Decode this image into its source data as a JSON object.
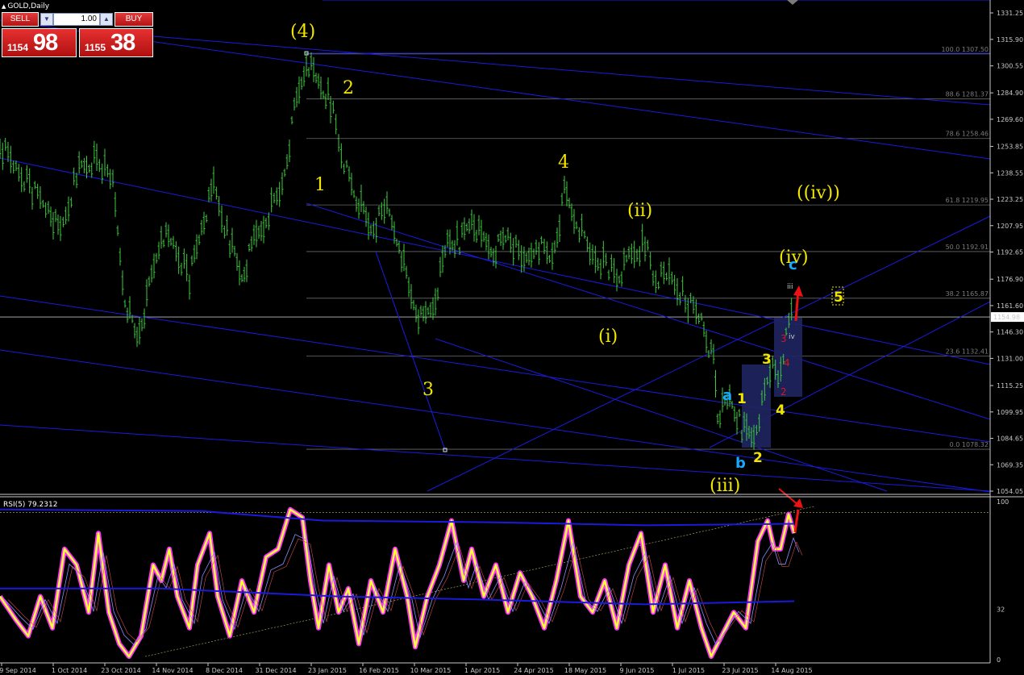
{
  "window": {
    "title": "GOLD,Daily",
    "menu_arrow_icon": "triangle-up-icon"
  },
  "trade_panel": {
    "sell_label": "SELL",
    "buy_label": "BUY",
    "lot_value": "1.00",
    "sell_price_small": "1154",
    "sell_price_big": "98",
    "buy_price_small": "1155",
    "buy_price_big": "38"
  },
  "price_axis": [
    "1331.25",
    "1315.90",
    "1300.55",
    "1284.90",
    "1269.60",
    "1253.85",
    "1238.55",
    "1223.25",
    "1207.95",
    "1192.65",
    "1176.90",
    "1161.60",
    "1146.30",
    "1131.00",
    "1115.25",
    "1099.95",
    "1084.65",
    "1069.35",
    "1054.05"
  ],
  "current_price": "1154.98",
  "fib_levels": [
    {
      "label": "100.0  1307.50",
      "price": 1307.5
    },
    {
      "label": "88.6  1281.37",
      "price": 1281.37
    },
    {
      "label": "78.6  1258.46",
      "price": 1258.46
    },
    {
      "label": "61.8  1219.95",
      "price": 1219.95
    },
    {
      "label": "50.0  1192.91",
      "price": 1192.91
    },
    {
      "label": "38.2  1165.87",
      "price": 1165.87
    },
    {
      "label": "23.6  1132.41",
      "price": 1132.41
    },
    {
      "label": "0.0  1078.32",
      "price": 1078.32
    }
  ],
  "date_axis": [
    "9 Sep 2014",
    "1 Oct 2014",
    "23 Oct 2014",
    "14 Nov 2014",
    "8 Dec 2014",
    "31 Dec 2014",
    "23 Jan 2015",
    "16 Feb 2015",
    "10 Mar 2015",
    "1 Apr 2015",
    "24 Apr 2015",
    "18 May 2015",
    "9 Jun 2015",
    "1 Jul 2015",
    "23 Jul 2015",
    "14 Aug 2015"
  ],
  "wave_labels": {
    "big": [
      "(4)",
      "(iii)",
      "(ii)",
      "(i)",
      "(iv)",
      "((iv))"
    ],
    "numbers": [
      "1",
      "2",
      "3",
      "4"
    ],
    "small_numbers": [
      "1",
      "2",
      "3",
      "4"
    ],
    "blue": [
      "a",
      "b",
      "c"
    ],
    "red": [
      "3",
      "4",
      "2"
    ],
    "tiny": [
      "iii",
      "iv"
    ],
    "box_five": "5"
  },
  "rsi": {
    "title": "RSI(5) 79.2312",
    "axis": [
      "100",
      "32",
      "0"
    ]
  },
  "colors": {
    "candle": "#3ec93e",
    "trendline": "#1a1adc",
    "wave_yellow": "#f2e600",
    "wave_blue": "#17a8ff",
    "rsi_main": "#ffff33",
    "rsi_glow": "#ff33ff",
    "arrow": "#ee1111"
  }
}
